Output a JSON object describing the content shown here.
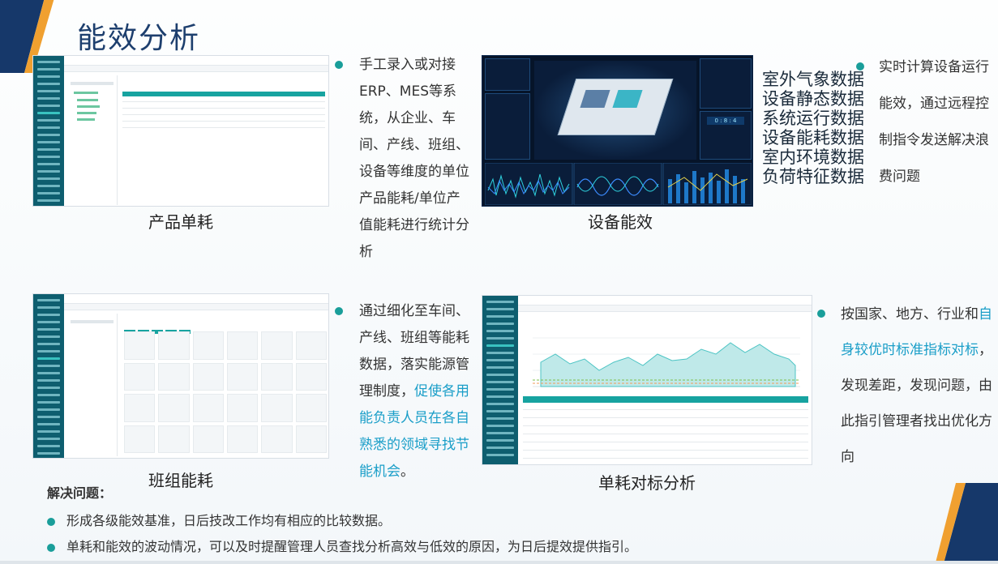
{
  "title": "能效分析",
  "panels": {
    "product": {
      "caption": "产品单耗",
      "bullet": "手工录入或对接ERP、MES等系统，从企业、车间、产线、班组、设备等维度的单位产品能耗/单位产值能耗进行统计分析"
    },
    "equipment": {
      "caption": "设备能效",
      "data_list": [
        "室外气象数据",
        "设备静态数据",
        "系统运行数据",
        "设备能耗数据",
        "室内环境数据",
        "负荷特征数据"
      ],
      "bullet": "实时计算设备运行能效，通过远程控制指令发送解决浪费问题"
    },
    "team": {
      "caption": "班组能耗",
      "bullet_plain": "通过细化至车间、产线、班组等能耗数据，落实能源管理制度，",
      "bullet_highlight": "促使各用能负责人员在各自熟悉的领域寻找节能机会",
      "bullet_end": "。"
    },
    "benchmark": {
      "caption": "单耗对标分析",
      "bullet_plain1": "按国家、地方、行业和",
      "bullet_highlight": "自身较优时标准指标对标",
      "bullet_plain2": "，发现差距，发现问题，由此指引管理者找出优化方向"
    }
  },
  "solve": {
    "heading": "解决问题：",
    "items": [
      "形成各级能效基准，日后技改工作均有相应的比较数据。",
      "单耗和能效的波动情况，可以及时提醒管理人员查找分析高效与低效的原因，为日后提效提供指引。"
    ]
  },
  "colors": {
    "accent_teal": "#1a9e9a",
    "highlight_blue": "#1a9ec8",
    "title_navy": "#1d3f6e",
    "corner_orange": "#f0a030",
    "corner_navy": "#16386a"
  }
}
